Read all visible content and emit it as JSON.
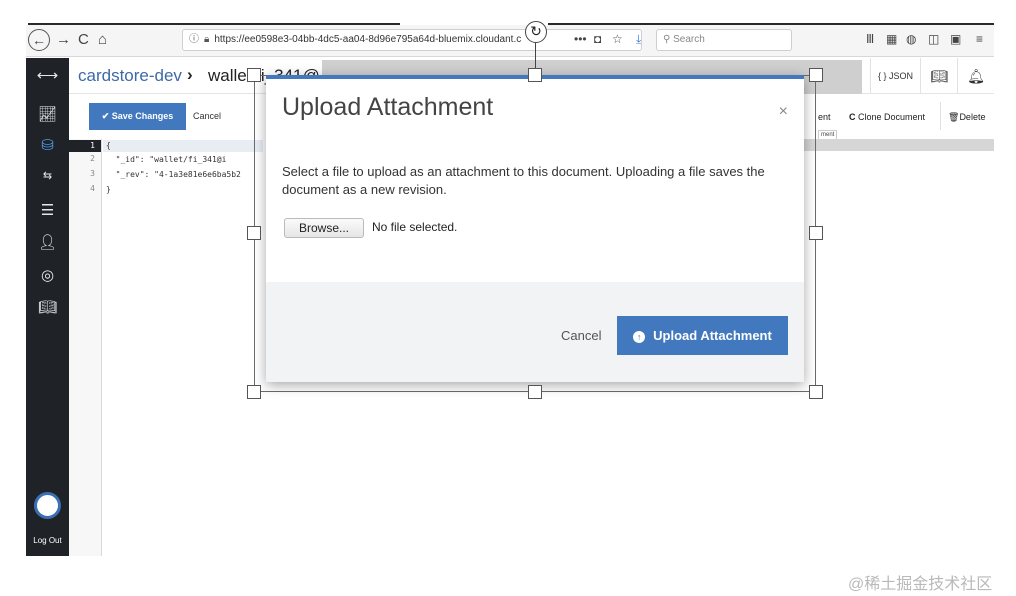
{
  "browser": {
    "url": "https://ee0598e3-04bb-4dc5-aa04-8d96e795a64d-bluemix.cloudant.c",
    "url_more": "•••",
    "search_placeholder": "Search"
  },
  "sidebar": {
    "logout_label": "Log Out"
  },
  "header": {
    "breadcrumb_root": "cardstore-dev",
    "breadcrumb_sep": "›",
    "breadcrumb_doc": "wallet/fi_341@",
    "json_label": "{ } JSON"
  },
  "toolbar": {
    "save_label": "Save Changes",
    "cancel_label": "Cancel",
    "attachment_label": "ent",
    "attachment_sub": "ment",
    "clone_label": "Clone Document",
    "delete_label": "Delete"
  },
  "editor": {
    "line_numbers": [
      "1",
      "2",
      "3",
      "4"
    ],
    "lines": [
      "{",
      "  \"_id\": \"wallet/fi_341@i",
      "  \"_rev\": \"4-1a3e81e6e6ba5b2",
      "}"
    ]
  },
  "modal": {
    "title": "Upload Attachment",
    "close": "×",
    "description": "Select a file to upload as an attachment to this document. Uploading a file saves the document as a new revision.",
    "browse_label": "Browse...",
    "file_status": "No file selected.",
    "cancel_label": "Cancel",
    "upload_label": "Upload Attachment"
  },
  "watermark": "@稀土掘金技术社区",
  "colors": {
    "accent": "#4178be",
    "sidebar_bg": "#1f2328"
  }
}
